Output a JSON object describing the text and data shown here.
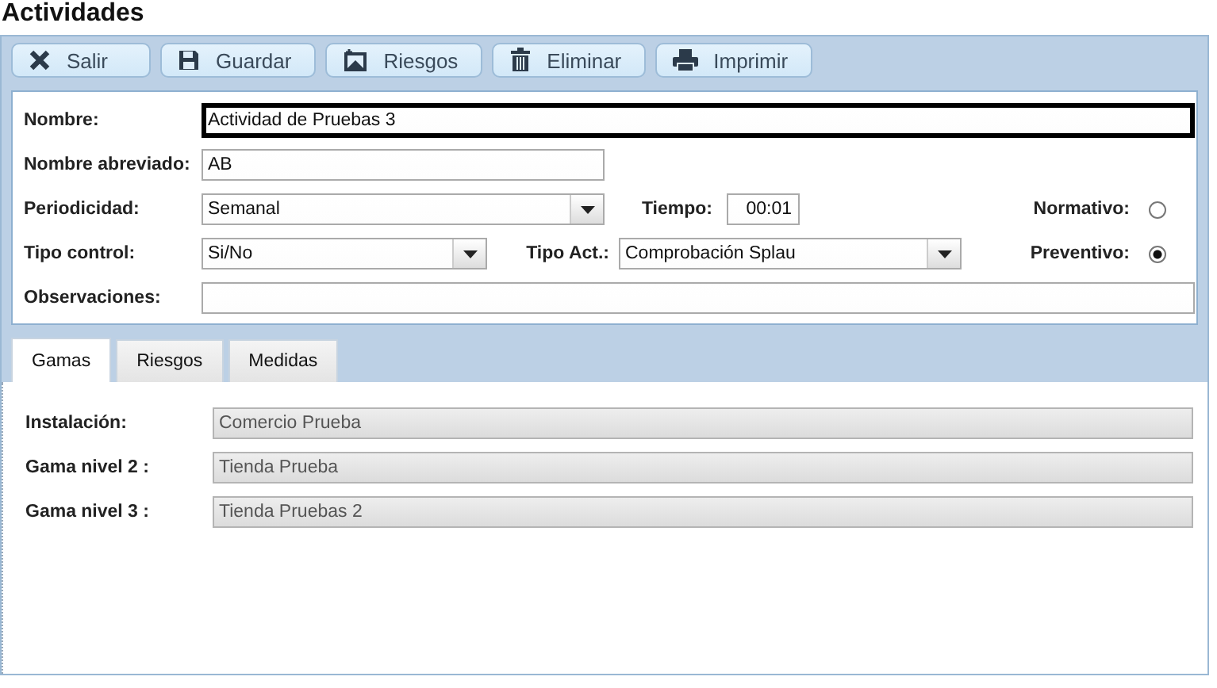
{
  "window": {
    "title": "Actividades"
  },
  "toolbar": [
    {
      "label": "Salir",
      "kind": "exit"
    },
    {
      "label": "Guardar",
      "kind": "save"
    },
    {
      "label": "Riesgos",
      "kind": "risks"
    },
    {
      "label": "Eliminar",
      "kind": "delete"
    },
    {
      "label": "Imprimir",
      "kind": "print"
    }
  ],
  "form": {
    "nombre": {
      "label": "Nombre:",
      "value": "Actividad de Pruebas 3",
      "focused": true
    },
    "nombre_abreviado": {
      "label": "Nombre abreviado:",
      "value": "AB"
    },
    "periodicidad": {
      "label": "Periodicidad:",
      "value": "Semanal"
    },
    "tiempo": {
      "label": "Tiempo:",
      "value": "00:01"
    },
    "normativo": {
      "label": "Normativo:",
      "selected": false
    },
    "tipo_control": {
      "label": "Tipo control:",
      "value": "Si/No"
    },
    "tipo_act": {
      "label": "Tipo Act.:",
      "value": "Comprobación Splau"
    },
    "preventivo": {
      "label": "Preventivo:",
      "selected": true
    },
    "observaciones": {
      "label": "Observaciones:"
    }
  },
  "tabs": [
    {
      "label": "Gamas",
      "selected": true
    },
    {
      "label": "Riesgos",
      "selected": false
    },
    {
      "label": "Medidas",
      "selected": false
    }
  ],
  "gamas": [
    {
      "label": "Instalación:",
      "value": "Comercio Prueba",
      "disabled": true
    },
    {
      "label": "Gama nivel 2 :",
      "value": "Tienda Prueba",
      "disabled": true
    },
    {
      "label": "Gama nivel 3 :",
      "value": "Tienda Pruebas 2",
      "disabled": true
    }
  ]
}
